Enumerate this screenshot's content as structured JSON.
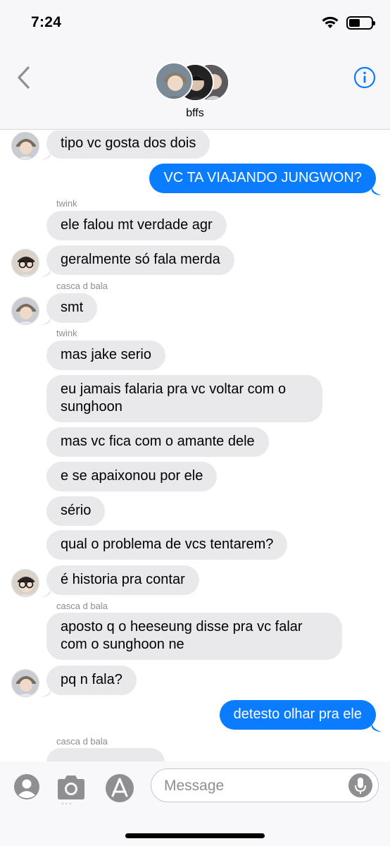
{
  "status": {
    "time": "7:24",
    "battery_level": 0.45
  },
  "header": {
    "group_name": "bffs",
    "back_icon": "chevron-left-icon",
    "info_icon": "info-icon"
  },
  "colors": {
    "sent_bubble": "#0a7cff",
    "received_bubble": "#e9e9eb",
    "accent": "#0a7cff"
  },
  "messages": {
    "m1": "tipo vc gosta dos dois",
    "m2": "VC TA VIAJANDO JUNGWON?",
    "s1": "twink",
    "m3": "ele falou mt verdade agr",
    "m4": "geralmente só fala merda",
    "s2": "casca d bala",
    "m5": "smt",
    "s3": "twink",
    "m6": "mas jake serio",
    "m7": "eu jamais falaria pra vc voltar com o sunghoon",
    "m8": "mas vc fica com o amante dele",
    "m9": "e se apaixonou por ele",
    "m10": "sério",
    "m11": "qual o problema de vcs tentarem?",
    "m12": "é historia pra contar",
    "s4": "casca d bala",
    "m13": "aposto q o heeseung disse pra vc falar com o sunghoon ne",
    "m14": "pq n fala?",
    "m15": "detesto olhar pra ele",
    "s5": "casca d bala"
  },
  "input": {
    "placeholder": "Message",
    "value": ""
  }
}
